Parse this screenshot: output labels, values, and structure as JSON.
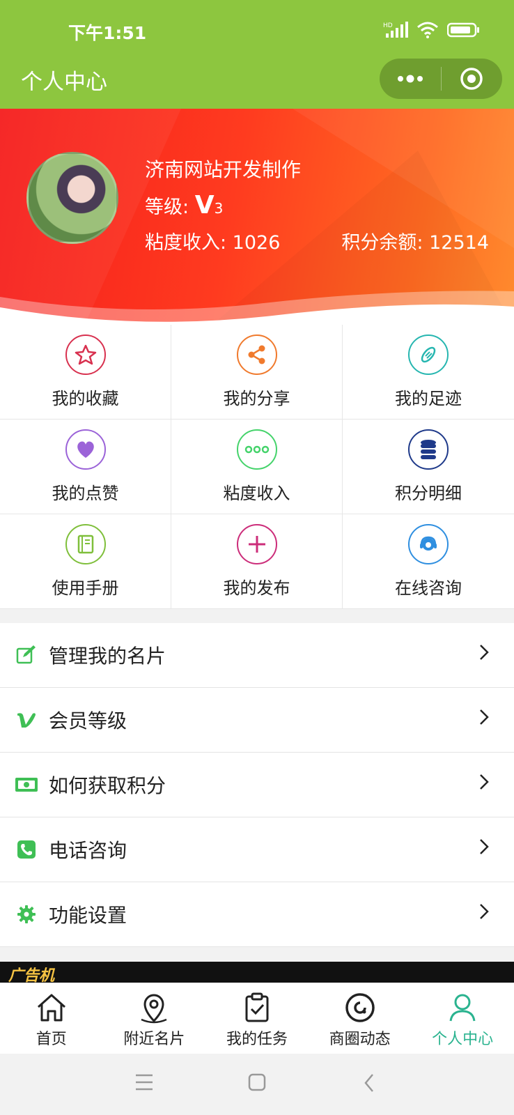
{
  "status_bar": {
    "time": "下午1:51",
    "signal_tag": "HD"
  },
  "nav": {
    "title": "个人中心"
  },
  "profile": {
    "name": "济南网站开发制作",
    "level_label": "等级:",
    "level_value": "V",
    "level_num": "3",
    "income": "粘度收入: 1026",
    "balance": "积分余额: 12514"
  },
  "grid": [
    {
      "label": "我的收藏",
      "icon": "star-icon",
      "color": "#d8314f"
    },
    {
      "label": "我的分享",
      "icon": "share-icon",
      "color": "#f07a2d"
    },
    {
      "label": "我的足迹",
      "icon": "footprint-icon",
      "color": "#26b6b0"
    },
    {
      "label": "我的点赞",
      "icon": "heart-icon",
      "color": "#9b63d8"
    },
    {
      "label": "粘度收入",
      "icon": "dots-icon",
      "color": "#45d36b"
    },
    {
      "label": "积分明细",
      "icon": "coins-icon",
      "color": "#1f3a8a"
    },
    {
      "label": "使用手册",
      "icon": "book-icon",
      "color": "#7fbf3b"
    },
    {
      "label": "我的发布",
      "icon": "plus-icon",
      "color": "#cc2d7a"
    },
    {
      "label": "在线咨询",
      "icon": "headset-icon",
      "color": "#2f8fe0"
    }
  ],
  "menu": [
    {
      "label": "管理我的名片",
      "icon": "edit-icon"
    },
    {
      "label": "会员等级",
      "icon": "vip-icon"
    },
    {
      "label": "如何获取积分",
      "icon": "money-icon"
    },
    {
      "label": "电话咨询",
      "icon": "phone-icon"
    },
    {
      "label": "功能设置",
      "icon": "gear-icon"
    }
  ],
  "ad": {
    "text": "广告机"
  },
  "tabs": [
    {
      "label": "首页",
      "icon": "home-icon"
    },
    {
      "label": "附近名片",
      "icon": "location-icon"
    },
    {
      "label": "我的任务",
      "icon": "task-icon"
    },
    {
      "label": "商圈动态",
      "icon": "circle-icon"
    },
    {
      "label": "个人中心",
      "icon": "user-icon",
      "active": true
    }
  ],
  "colors": {
    "brand_green": "#8dc63f",
    "active_tab": "#2ab38f",
    "menu_icon_green": "#3fbf55"
  }
}
